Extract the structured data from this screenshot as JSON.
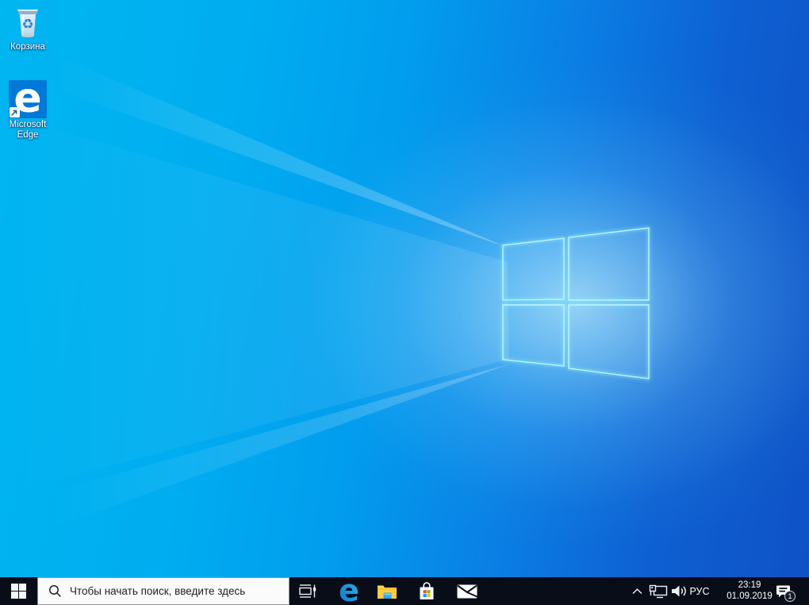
{
  "desktop": {
    "icons": [
      {
        "name": "recycle-bin",
        "label": "Корзина"
      },
      {
        "name": "microsoft-edge-shortcut",
        "label": "Microsoft Edge"
      }
    ]
  },
  "logos": {
    "edge_letter": "e",
    "recycle_glyph": "♻"
  },
  "taskbar": {
    "search": {
      "placeholder": "Чтобы начать поиск, введите здесь"
    },
    "tray": {
      "language": "РУС",
      "time": "23:19",
      "date": "01.09.2019",
      "notification_badge": "1"
    },
    "icon_names": {
      "start": "windows-logo",
      "search": "magnifier",
      "task_view": "task-view-timeline",
      "edge": "edge-e",
      "file_explorer": "yellow-folder",
      "store": "shopping-bag-with-ms-logo",
      "mail": "envelope",
      "tray_expand": "chevron-up",
      "network": "ethernet-monitor",
      "volume": "speaker-with-waves",
      "action_center": "notification-bubble"
    }
  },
  "colors": {
    "accent_blue": "#0078d7",
    "taskbar_bg": "#080d18",
    "wallpaper_light": "#00b6f1",
    "wallpaper_deep": "#0e52c6",
    "logo_edge_glow": "#7deaff",
    "store_red": "#f25022",
    "store_green": "#7fba00",
    "store_blue": "#00a4ef",
    "store_yellow": "#ffb900",
    "folder_yellow": "#ffc836",
    "recycle_symbol_blue": "#2e7fd6"
  }
}
